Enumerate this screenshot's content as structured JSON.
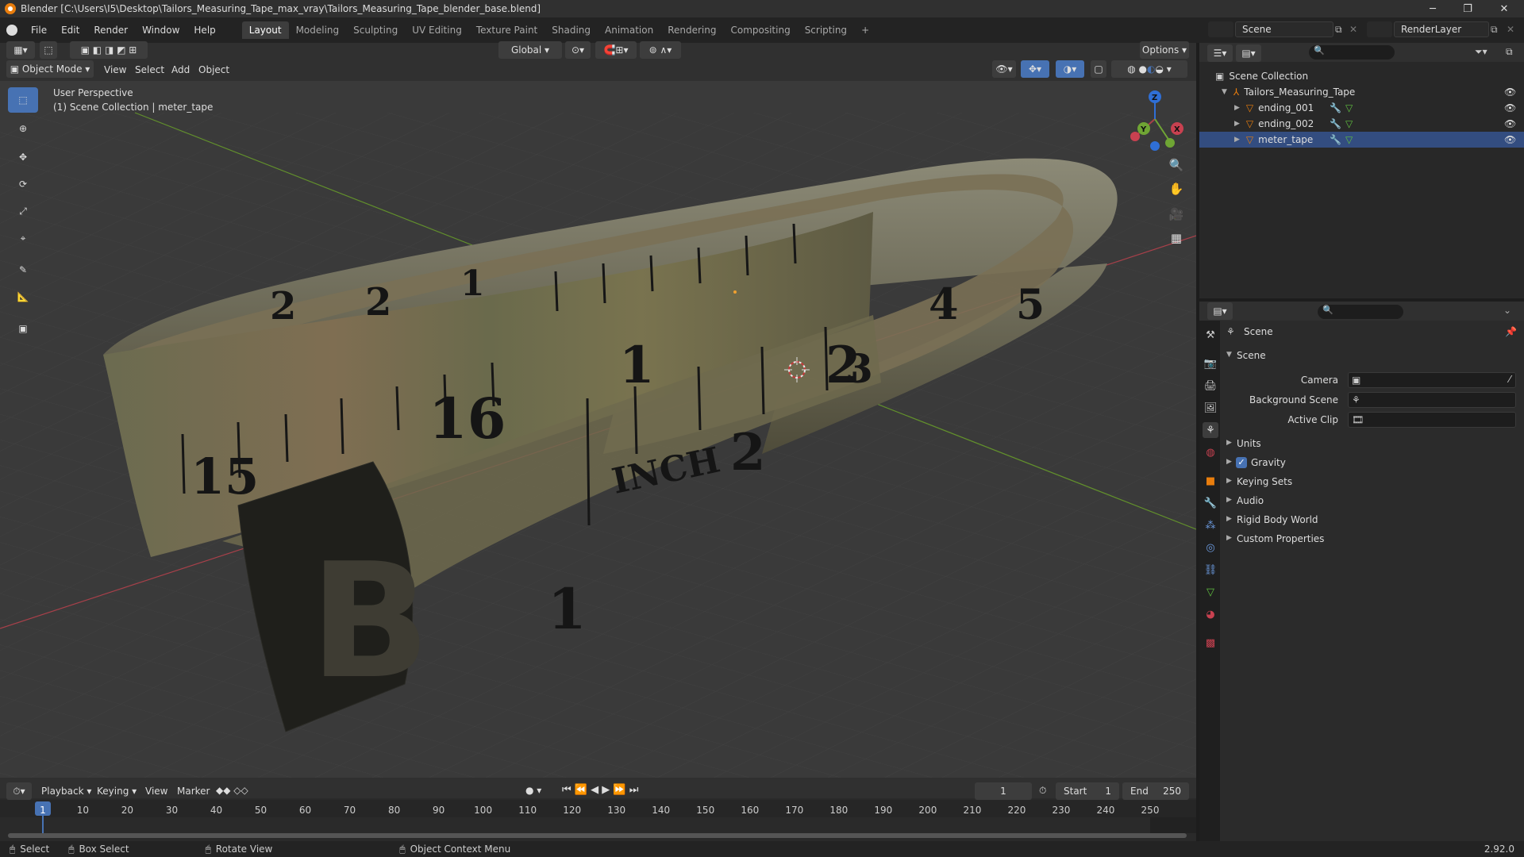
{
  "window": {
    "title": "Blender [C:\\Users\\I5\\Desktop\\Tailors_Measuring_Tape_max_vray\\Tailors_Measuring_Tape_blender_base.blend]",
    "minimize": "─",
    "maximize": "❐",
    "close": "✕"
  },
  "menu": [
    "File",
    "Edit",
    "Render",
    "Window",
    "Help"
  ],
  "workspaces": [
    "Layout",
    "Modeling",
    "Sculpting",
    "UV Editing",
    "Texture Paint",
    "Shading",
    "Animation",
    "Rendering",
    "Compositing",
    "Scripting"
  ],
  "workspace_add": "+",
  "scene": {
    "name": "Scene",
    "view_layer": "RenderLayer"
  },
  "viewport_header": {
    "transform_orientation": "Global",
    "options": "Options",
    "mode": "Object Mode",
    "menus": [
      "View",
      "Select",
      "Add",
      "Object"
    ]
  },
  "viewport": {
    "perspective": "User Perspective",
    "collection_info": "(1) Scene Collection | meter_tape",
    "gizmo": {
      "x": "X",
      "y": "Y",
      "z": "Z"
    },
    "model_marks": [
      "15",
      "16",
      "1",
      "INCH",
      "1",
      "2",
      "2",
      "3",
      "4",
      "5",
      "2",
      "2",
      "1",
      "B"
    ]
  },
  "toolbar": [
    "select-box",
    "cursor",
    "move",
    "rotate",
    "scale",
    "transform",
    "annotate",
    "measure",
    "add-cube"
  ],
  "outliner": {
    "root": "Scene Collection",
    "collection": "Tailors_Measuring_Tape",
    "objects": [
      "ending_001",
      "ending_002",
      "meter_tape"
    ]
  },
  "properties": {
    "breadcrumb": "Scene",
    "panel_title": "Scene",
    "fields": [
      {
        "label": "Camera",
        "value": ""
      },
      {
        "label": "Background Scene",
        "value": ""
      },
      {
        "label": "Active Clip",
        "value": ""
      }
    ],
    "subpanels": [
      "Units",
      "Gravity",
      "Keying Sets",
      "Audio",
      "Rigid Body World",
      "Custom Properties"
    ],
    "gravity_checked": true
  },
  "timeline": {
    "menus": [
      "Playback",
      "Keying",
      "View",
      "Marker"
    ],
    "current_frame": "1",
    "start_label": "Start",
    "start_value": "1",
    "end_label": "End",
    "end_value": "250",
    "ruler": [
      "1",
      "10",
      "20",
      "30",
      "40",
      "50",
      "60",
      "70",
      "80",
      "90",
      "100",
      "110",
      "120",
      "130",
      "140",
      "150",
      "160",
      "170",
      "180",
      "190",
      "200",
      "210",
      "220",
      "230",
      "240",
      "250"
    ]
  },
  "status": {
    "select": "Select",
    "box_select": "Box Select",
    "rotate_view": "Rotate View",
    "context_menu": "Object Context Menu",
    "version": "2.92.0"
  },
  "colors": {
    "accent": "#4772b3",
    "orange": "#e87d0d",
    "x_axis": "#c84150",
    "y_axis": "#6fa534",
    "z_axis": "#2f6fd6"
  }
}
